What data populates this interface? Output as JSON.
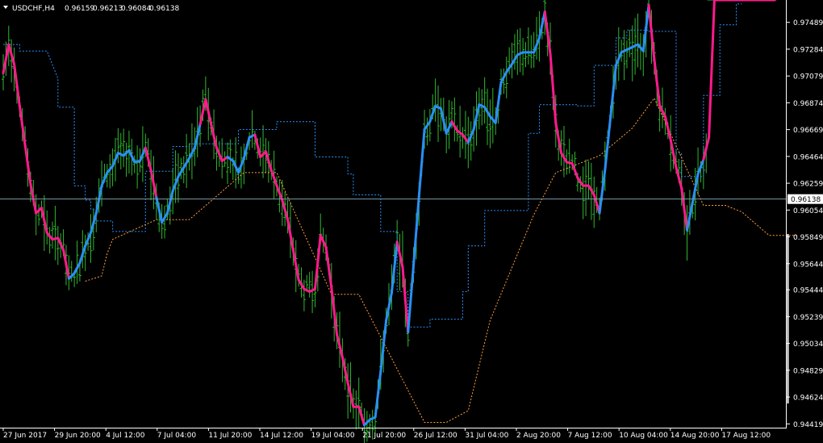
{
  "header": {
    "symbol": "USDCHF,H4",
    "open": "0.96159",
    "high": "0.96213",
    "low": "0.96084",
    "close": "0.96138"
  },
  "colors": {
    "background": "#000000",
    "bars": "#2fb82f",
    "trend_up": "#2a8ff5",
    "trend_down": "#ff1a8c",
    "upper_channel": "#2a8ff5",
    "lower_channel": "#ff9e3d",
    "current_price_line": "#7a9aa8"
  },
  "chart_data": {
    "type": "line",
    "symbol": "USDCHF",
    "timeframe": "H4",
    "x_tick_labels": [
      "27 Jun 2017",
      "29 Jun 20:00",
      "4 Jul 12:00",
      "7 Jul 04:00",
      "11 Jul 20:00",
      "14 Jul 12:00",
      "19 Jul 04:00",
      "21 Jul 20:00",
      "26 Jul 12:00",
      "31 Jul 04:00",
      "2 Aug 20:00",
      "7 Aug 12:00",
      "10 Aug 04:00",
      "14 Aug 20:00",
      "17 Aug 12:00"
    ],
    "y_ticks": [
      0.97489,
      0.97284,
      0.97079,
      0.96874,
      0.96669,
      0.96464,
      0.96259,
      0.96054,
      0.95849,
      0.95644,
      0.95444,
      0.95239,
      0.95034,
      0.94829,
      0.94624,
      0.94419
    ],
    "y_tick_labels": [
      "0.97489",
      "0.97284",
      "0.97079",
      "0.96874",
      "0.96669",
      "0.96464",
      "0.96259",
      "0.96054",
      "0.95849",
      "0.95644",
      "0.95444",
      "0.95239",
      "0.95034",
      "0.94829",
      "0.94624",
      "0.94419"
    ],
    "ylim": [
      0.9439,
      0.9766
    ],
    "current_price": 0.96138,
    "current_price_label": "0.96138",
    "grid": false,
    "trend_line": {
      "x": [
        0,
        2,
        4,
        6,
        8,
        10,
        12,
        14,
        16,
        18,
        20,
        22,
        24,
        26,
        28,
        30,
        32,
        34,
        36,
        38,
        40,
        42,
        44,
        46,
        48,
        50,
        52,
        54,
        56,
        58,
        60,
        62,
        64,
        66,
        68,
        70,
        72,
        74,
        76,
        78,
        80,
        82,
        84,
        86,
        88,
        90,
        92,
        94,
        96,
        98,
        100,
        102,
        104,
        106,
        108,
        110,
        112,
        114,
        116,
        118,
        120,
        122,
        124,
        126,
        128,
        130,
        132,
        134,
        136,
        138,
        140,
        142,
        144,
        146,
        148,
        150,
        152,
        154,
        156,
        158,
        160,
        162,
        164,
        166,
        168,
        170,
        172,
        174,
        176,
        178,
        180,
        182,
        184,
        186,
        188,
        190,
        192,
        194,
        196,
        198,
        200,
        202,
        204,
        206,
        208,
        210,
        212,
        214,
        216,
        218,
        220,
        222,
        224,
        226,
        228,
        230,
        232,
        234,
        236,
        238,
        240,
        242,
        244,
        246,
        248,
        250,
        252,
        254,
        256,
        258,
        260,
        262,
        264,
        266,
        268,
        270,
        272,
        274,
        276,
        278,
        280,
        282
      ],
      "values": [
        0.971,
        0.9732,
        0.9717,
        0.9685,
        0.9655,
        0.9625,
        0.9603,
        0.9607,
        0.9588,
        0.9583,
        0.9584,
        0.9575,
        0.9553,
        0.9557,
        0.9565,
        0.9578,
        0.9588,
        0.9603,
        0.9624,
        0.9634,
        0.9639,
        0.9649,
        0.9647,
        0.9651,
        0.9642,
        0.9643,
        0.9653,
        0.9636,
        0.9615,
        0.9596,
        0.9603,
        0.962,
        0.9631,
        0.9638,
        0.9645,
        0.9653,
        0.9671,
        0.969,
        0.9671,
        0.9653,
        0.9643,
        0.9646,
        0.9643,
        0.9634,
        0.9645,
        0.9661,
        0.9663,
        0.9646,
        0.965,
        0.9636,
        0.9624,
        0.9613,
        0.9598,
        0.9575,
        0.9552,
        0.9545,
        0.9543,
        0.9545,
        0.9586,
        0.9577,
        0.9546,
        0.951,
        0.9493,
        0.9473,
        0.9455,
        0.9455,
        0.9441,
        0.9445,
        0.9447,
        0.9482,
        0.9521,
        0.9542,
        0.9581,
        0.9562,
        0.9512,
        0.9563,
        0.9616,
        0.9667,
        0.9673,
        0.9685,
        0.9683,
        0.9664,
        0.9673,
        0.9666,
        0.9663,
        0.9657,
        0.9667,
        0.9686,
        0.9684,
        0.9677,
        0.9672,
        0.9703,
        0.9711,
        0.9717,
        0.9724,
        0.9726,
        0.9726,
        0.9726,
        0.9737,
        0.9757,
        0.9725,
        0.9672,
        0.9649,
        0.9642,
        0.9641,
        0.963,
        0.9624,
        0.9624,
        0.9617,
        0.9603,
        0.9636,
        0.9676,
        0.9716,
        0.9726,
        0.9728,
        0.973,
        0.9732,
        0.9727,
        0.9762,
        0.9721,
        0.9685,
        0.9677,
        0.9659,
        0.9638,
        0.9622,
        0.959,
        0.9611,
        0.9633,
        0.9644,
        0.9661
      ],
      "direction": [
        "down",
        "down",
        "down",
        "down",
        "down",
        "down",
        "down",
        "down",
        "down",
        "down",
        "down",
        "down",
        "up",
        "up",
        "up",
        "up",
        "up",
        "up",
        "up",
        "up",
        "up",
        "up",
        "up",
        "up",
        "up",
        "up",
        "down",
        "down",
        "up",
        "up",
        "up",
        "up",
        "up",
        "up",
        "up",
        "up",
        "down",
        "down",
        "down",
        "down",
        "down",
        "up",
        "up",
        "up",
        "up",
        "up",
        "down",
        "down",
        "down",
        "down",
        "down",
        "down",
        "down",
        "down",
        "down",
        "down",
        "down",
        "down",
        "down",
        "down",
        "down",
        "down",
        "down",
        "down",
        "down",
        "down",
        "up",
        "up",
        "up",
        "up",
        "up",
        "up",
        "down",
        "down",
        "up",
        "up",
        "up",
        "up",
        "up",
        "up",
        "up",
        "up",
        "down",
        "down",
        "down",
        "up",
        "up",
        "up",
        "up",
        "up",
        "up",
        "up",
        "up",
        "up",
        "up",
        "up",
        "up",
        "up",
        "up",
        "down",
        "down",
        "down",
        "down",
        "down",
        "down",
        "down",
        "down",
        "down",
        "down",
        "up",
        "up",
        "up",
        "up",
        "up",
        "up",
        "up",
        "up",
        "up",
        "down",
        "down",
        "down",
        "down",
        "down",
        "down",
        "down",
        "up",
        "up",
        "up",
        "down",
        "down"
      ]
    },
    "upper_channel": {
      "x": [
        0,
        6,
        6,
        16,
        20,
        20,
        26,
        26,
        30,
        30,
        32,
        32,
        34,
        34,
        40,
        40,
        52,
        52,
        62,
        62,
        68,
        68,
        86,
        86,
        100,
        100,
        114,
        114,
        126,
        126,
        128,
        128,
        138,
        138,
        144,
        144,
        148,
        148,
        156,
        156,
        168,
        168,
        170,
        170,
        176,
        176,
        192,
        192,
        196,
        196,
        210,
        210,
        216,
        216,
        224,
        224,
        228,
        228,
        236,
        236,
        246,
        246,
        248,
        248,
        256,
        256,
        262,
        262,
        268,
        268,
        270,
        270,
        282
      ],
      "values": [
        0.9732,
        0.9732,
        0.9727,
        0.9727,
        0.9706,
        0.9684,
        0.9684,
        0.9624,
        0.9624,
        0.9613,
        0.9613,
        0.9606,
        0.9606,
        0.9597,
        0.9597,
        0.9589,
        0.9589,
        0.9635,
        0.9635,
        0.9654,
        0.9654,
        0.9656,
        0.9656,
        0.9667,
        0.9667,
        0.9673,
        0.9673,
        0.9646,
        0.9646,
        0.9633,
        0.9633,
        0.9617,
        0.9617,
        0.9589,
        0.9589,
        0.9543,
        0.9543,
        0.9516,
        0.9516,
        0.9522,
        0.9522,
        0.9543,
        0.9543,
        0.9578,
        0.9578,
        0.9605,
        0.9605,
        0.9664,
        0.9664,
        0.9686,
        0.9686,
        0.9685,
        0.9685,
        0.9716,
        0.9716,
        0.9737,
        0.9737,
        0.9743,
        0.9743,
        0.9742,
        0.9742,
        0.9649,
        0.9649,
        0.9631,
        0.9631,
        0.9693,
        0.9693,
        0.9747,
        0.9747,
        0.9763,
        0.9763,
        0.9763
      ]
    },
    "lower_channel": {
      "x": [
        30,
        30,
        36,
        36,
        38,
        38,
        40,
        40,
        56,
        56,
        60,
        60,
        68,
        68,
        88,
        88,
        100,
        100,
        120,
        120,
        130,
        130,
        154,
        154,
        162,
        162,
        170,
        170,
        178,
        178,
        194,
        194,
        202,
        202,
        218,
        218,
        230,
        230,
        238,
        238,
        256,
        256,
        264,
        264,
        270,
        270,
        280,
        280,
        290
      ],
      "values": [
        0.9551,
        0.9551,
        0.9555,
        0.9555,
        0.9572,
        0.9572,
        0.9583,
        0.9583,
        0.9598,
        0.9598,
        0.9598,
        0.9598,
        0.9598,
        0.9598,
        0.9634,
        0.9634,
        0.9634,
        0.9634,
        0.9541,
        0.9541,
        0.9541,
        0.9541,
        0.9443,
        0.9443,
        0.9443,
        0.9443,
        0.9452,
        0.9452,
        0.9521,
        0.9521,
        0.9602,
        0.9602,
        0.9634,
        0.9634,
        0.9647,
        0.9647,
        0.9668,
        0.9668,
        0.9691,
        0.9691,
        0.9609,
        0.9609,
        0.9609,
        0.9609,
        0.9604,
        0.9604,
        0.9586,
        0.9586,
        0.9586
      ]
    }
  }
}
